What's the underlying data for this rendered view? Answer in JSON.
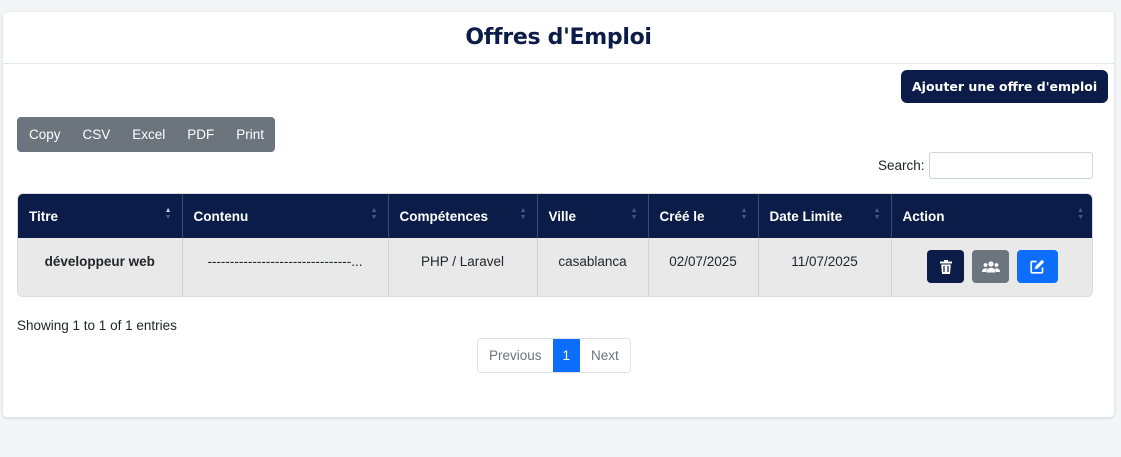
{
  "header": {
    "title": "Offres d'Emploi"
  },
  "toolbar": {
    "add_label": "Ajouter une offre d'emploi"
  },
  "export_buttons": [
    "Copy",
    "CSV",
    "Excel",
    "PDF",
    "Print"
  ],
  "search": {
    "label": "Search:",
    "value": ""
  },
  "table": {
    "columns": [
      "Titre",
      "Contenu",
      "Compétences",
      "Ville",
      "Créé le",
      "Date Limite",
      "Action"
    ],
    "rows": [
      {
        "titre": "développeur web",
        "contenu": "--------------------------------...",
        "competences": "PHP / Laravel",
        "ville": "casablanca",
        "cree_le": "02/07/2025",
        "date_limite": "11/07/2025",
        "actions": [
          "trash-icon",
          "users-icon",
          "edit-icon"
        ]
      }
    ]
  },
  "footer": {
    "info": "Showing 1 to 1 of 1 entries",
    "pagination": {
      "previous": "Previous",
      "current": "1",
      "next": "Next"
    }
  },
  "colors": {
    "primary_dark": "#0b1c48",
    "secondary": "#6c757d",
    "accent": "#0d6efd"
  }
}
